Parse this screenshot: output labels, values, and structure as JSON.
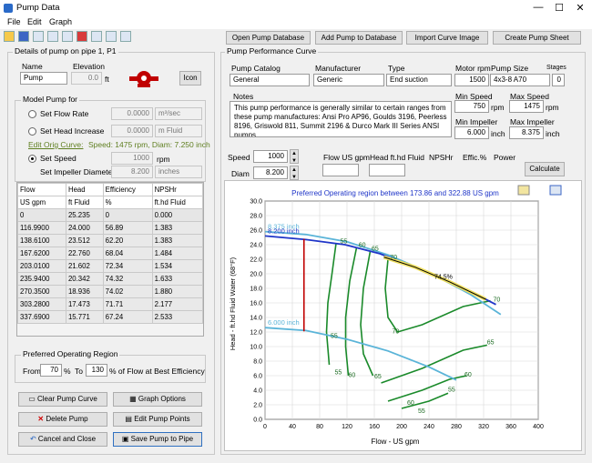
{
  "window": {
    "title": "Pump Data",
    "minimize": "—",
    "maximize": "☐",
    "close": "✕"
  },
  "menu": [
    "File",
    "Edit",
    "Graph"
  ],
  "toolbar_icons": [
    "folder-icon",
    "save-icon",
    "print-icon",
    "print-preview-icon",
    "copy-icon",
    "pdf-icon",
    "image-icon",
    "clipboard-icon",
    "export-icon",
    "chart-icon"
  ],
  "left": {
    "group_title": "Details of pump on pipe 1, P1",
    "name_label": "Name",
    "name_value": "Pump",
    "elevation_label": "Elevation",
    "elevation_value": "0.0",
    "elevation_unit": "ft",
    "icon_button": "Icon",
    "model_group": "Model Pump for",
    "flow_rate_label": "Set Flow Rate",
    "flow_rate_value": "0.0000",
    "flow_rate_unit": "m³/sec",
    "head_inc_label": "Set Head Increase",
    "head_inc_value": "0.0000",
    "head_inc_unit": "m Fluid",
    "edit_orig": "Edit Orig Curve:",
    "speed_diam_text": "Speed: 1475 rpm, Diam: 7.250 inch",
    "set_speed_label": "Set Speed",
    "set_speed_value": "1000",
    "set_speed_unit": "rpm",
    "set_diam_label": "Set Impeller Diameter",
    "set_diam_value": "8.200",
    "set_diam_unit": "inches",
    "table": {
      "headers": [
        "Flow",
        "Head",
        "Efficiency",
        "NPSHr"
      ],
      "units": [
        "US gpm",
        "ft Fluid",
        "%",
        "ft.hd Fluid"
      ],
      "rows": [
        [
          "0",
          "25.235",
          "0",
          "0.000"
        ],
        [
          "116.9900",
          "24.000",
          "56.89",
          "1.383"
        ],
        [
          "138.6100",
          "23.512",
          "62.20",
          "1.383"
        ],
        [
          "167.6200",
          "22.760",
          "68.04",
          "1.484"
        ],
        [
          "203.0100",
          "21.602",
          "72.34",
          "1.534"
        ],
        [
          "235.9400",
          "20.342",
          "74.32",
          "1.633"
        ],
        [
          "270.3500",
          "18.936",
          "74.02",
          "1.880"
        ],
        [
          "303.2800",
          "17.473",
          "71.71",
          "2.177"
        ],
        [
          "337.6900",
          "15.771",
          "67.24",
          "2.533"
        ]
      ]
    },
    "por_group": "Preferred Operating Region",
    "por_from": "From",
    "por_from_value": "70",
    "por_pct": "%",
    "por_to": "To",
    "por_to_value": "130",
    "por_tail": "% of Flow at Best Efficiency",
    "buttons": {
      "clear": "Clear Pump Curve",
      "graph_options": "Graph Options",
      "delete": "Delete Pump",
      "edit_points": "Edit Pump Points",
      "cancel": "Cancel and Close",
      "save": "Save Pump to Pipe"
    }
  },
  "right": {
    "top_buttons": [
      "Open Pump Database",
      "Add Pump to Database",
      "Import Curve Image",
      "Create Pump Sheet"
    ],
    "group_title": "Pump Performance Curve",
    "catalog_label": "Pump Catalog",
    "catalog_value": "General",
    "manufacturer_label": "Manufacturer",
    "manufacturer_value": "Generic",
    "type_label": "Type",
    "type_value": "End suction",
    "motor_label": "Motor rpm",
    "motor_value": "1500",
    "size_label": "Pump Size",
    "size_value": "4x3-8 A70",
    "stages_label": "Stages",
    "stages_value": "0",
    "notes_label": "Notes",
    "notes_value": "This pump performance is generally similar to certain ranges from these pump manufactures: Ansi Pro AP96, Goulds 3196, Peerless 8196, Griswold 811, Summit 2196 & Durco Mark III Series ANSI pumps",
    "min_speed_label": "Min Speed",
    "min_speed_value": "750",
    "min_speed_unit": "rpm",
    "max_speed_label": "Max Speed",
    "max_speed_value": "1475",
    "max_speed_unit": "rpm",
    "min_imp_label": "Min Impeller",
    "min_imp_value": "6.000",
    "min_imp_unit": "inch",
    "max_imp_label": "Max Impeller",
    "max_imp_value": "8.375",
    "max_imp_unit": "inch",
    "speed_label": "Speed",
    "speed_value": "1000",
    "diam_label": "Diam",
    "diam_value": "8.200",
    "calc_labels": [
      "Flow US gpm",
      "Head ft.hd Fluid",
      "NPSHr",
      "Effic.%",
      "Power"
    ],
    "calculate": "Calculate"
  },
  "chart_data": {
    "type": "line",
    "title": "Preferred Operating region between 173.86 and 322.88 US gpm",
    "xlabel": "Flow - US gpm",
    "ylabel": "Head - ft.hd Fluid Water (68°F)",
    "xlim": [
      0,
      400
    ],
    "ylim": [
      0,
      30
    ],
    "xticks": [
      0,
      40,
      80,
      120,
      160,
      200,
      240,
      280,
      320,
      360,
      400
    ],
    "yticks": [
      "0.0",
      "2.0",
      "4.0",
      "6.0",
      "8.0",
      "10.0",
      "12.0",
      "14.0",
      "16.0",
      "18.0",
      "20.0",
      "22.0",
      "24.0",
      "26.0",
      "28.0",
      "30.0"
    ],
    "series": [
      {
        "name": "8.375 inch",
        "color": "#5ab4d8",
        "points": [
          [
            0,
            25.8
          ],
          [
            60,
            25.4
          ],
          [
            120,
            24.4
          ],
          [
            180,
            22.6
          ],
          [
            240,
            20.2
          ],
          [
            300,
            17.2
          ],
          [
            345,
            14.4
          ]
        ]
      },
      {
        "name": "8.200 inch",
        "color": "#1f35c8",
        "points": [
          [
            0,
            25.2
          ],
          [
            60,
            24.7
          ],
          [
            117,
            24.0
          ],
          [
            168,
            22.76
          ],
          [
            236,
            20.34
          ],
          [
            270,
            18.94
          ],
          [
            303,
            17.47
          ],
          [
            338,
            15.77
          ]
        ]
      },
      {
        "name": "6.000 inch",
        "color": "#5ab4d8",
        "points": [
          [
            0,
            12.6
          ],
          [
            60,
            12.2
          ],
          [
            120,
            11.0
          ],
          [
            180,
            9.4
          ],
          [
            240,
            7.2
          ],
          [
            280,
            5.4
          ]
        ]
      },
      {
        "name": "",
        "color": "#f0e060",
        "points": [
          [
            174,
            22.3
          ],
          [
            220,
            20.9
          ],
          [
            270,
            18.9
          ],
          [
            323,
            16.5
          ]
        ]
      },
      {
        "name": "",
        "color": "#000000",
        "points": [
          [
            174,
            22.3
          ],
          [
            220,
            20.9
          ],
          [
            270,
            18.9
          ],
          [
            323,
            16.5
          ]
        ]
      }
    ],
    "efficiency_labels": [
      {
        "text": "55",
        "x": 110,
        "y": 24.2
      },
      {
        "text": "60",
        "x": 137,
        "y": 23.7
      },
      {
        "text": "65",
        "x": 156,
        "y": 23.2
      },
      {
        "text": "70",
        "x": 183,
        "y": 22.0
      },
      {
        "text": "74.5%",
        "x": 248,
        "y": 19.3
      },
      {
        "text": "70",
        "x": 334,
        "y": 16.2
      },
      {
        "text": "55",
        "x": 96,
        "y": 11.2
      },
      {
        "text": "55",
        "x": 102,
        "y": 6.2
      },
      {
        "text": "60",
        "x": 122,
        "y": 5.8
      },
      {
        "text": "65",
        "x": 160,
        "y": 5.6
      },
      {
        "text": "70",
        "x": 186,
        "y": 11.8
      },
      {
        "text": "65",
        "x": 325,
        "y": 10.3
      },
      {
        "text": "60",
        "x": 292,
        "y": 5.9
      },
      {
        "text": "55",
        "x": 268,
        "y": 3.8
      },
      {
        "text": "60",
        "x": 208,
        "y": 2.0
      },
      {
        "text": "55",
        "x": 224,
        "y": 0.9
      }
    ],
    "efficiency_curves": [
      [
        [
          104,
          24.2
        ],
        [
          98,
          20
        ],
        [
          92,
          16
        ],
        [
          90,
          12
        ],
        [
          94,
          7.5
        ]
      ],
      [
        [
          134,
          23.6
        ],
        [
          124,
          19
        ],
        [
          118,
          14
        ],
        [
          118,
          10
        ],
        [
          122,
          6
        ]
      ],
      [
        [
          154,
          23.1
        ],
        [
          144,
          18
        ],
        [
          140,
          13
        ],
        [
          144,
          9
        ],
        [
          158,
          6
        ]
      ],
      [
        [
          180,
          22
        ],
        [
          176,
          18
        ],
        [
          180,
          14
        ],
        [
          194,
          12
        ],
        [
          230,
          13
        ],
        [
          290,
          15.5
        ],
        [
          330,
          16.3
        ]
      ],
      [
        [
          170,
          5
        ],
        [
          230,
          7
        ],
        [
          290,
          9.5
        ],
        [
          325,
          10.2
        ]
      ],
      [
        [
          180,
          2.5
        ],
        [
          230,
          4
        ],
        [
          270,
          5.5
        ],
        [
          295,
          6
        ]
      ],
      [
        [
          200,
          1.5
        ],
        [
          240,
          2.5
        ],
        [
          268,
          3.6
        ]
      ]
    ],
    "impeller_marker": {
      "x": 57,
      "y0": 12.1,
      "y1": 24.8,
      "color": "#c00000"
    },
    "npsh_marker_x": 322
  }
}
